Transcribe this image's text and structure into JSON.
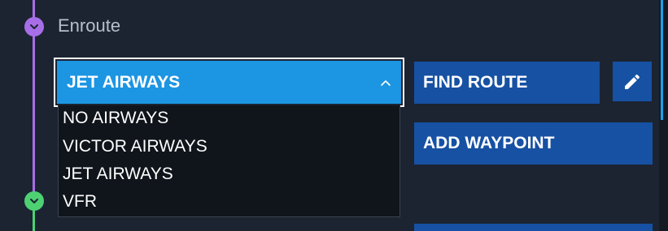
{
  "section": {
    "title": "Enroute"
  },
  "timeline": {
    "colors": {
      "top_segment": "#e56b5a",
      "enroute": "#a86ee8",
      "next": "#4dd173"
    },
    "nodes": [
      "chevron-down-icon",
      "chevron-down-icon"
    ]
  },
  "airway_dropdown": {
    "selected": "JET AIRWAYS",
    "expanded_icon": "chevron-up-icon",
    "options": [
      "NO AIRWAYS",
      "VICTOR AIRWAYS",
      "JET AIRWAYS",
      "VFR"
    ]
  },
  "buttons": {
    "find_route": "FIND ROUTE",
    "edit_icon": "pencil-icon",
    "add_waypoint": "ADD WAYPOINT"
  },
  "colors": {
    "background": "#1c2431",
    "selected_accent": "#1c95e3",
    "button_bg": "#1651a3",
    "dropdown_bg": "#10151c",
    "scroll_accent": "#1ba1e8"
  }
}
